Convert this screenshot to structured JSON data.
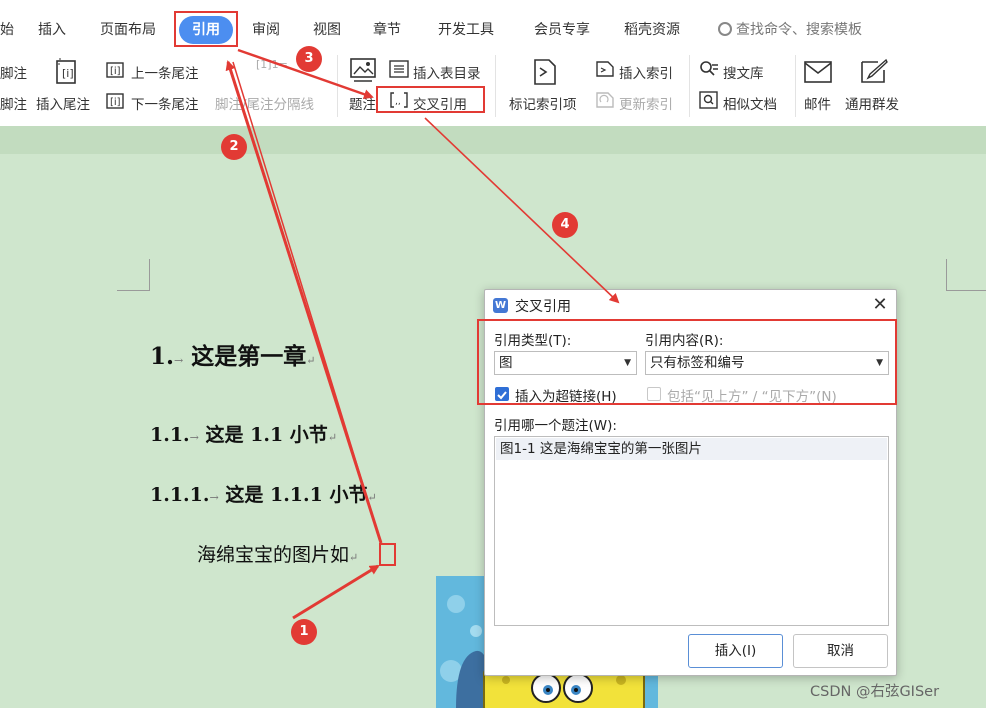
{
  "ribbon": {
    "tabs": [
      {
        "label": "始"
      },
      {
        "label": "插入"
      },
      {
        "label": "页面布局"
      },
      {
        "label": "引用"
      },
      {
        "label": "审阅"
      },
      {
        "label": "视图"
      },
      {
        "label": "章节"
      },
      {
        "label": "开发工具"
      },
      {
        "label": "会员专享"
      },
      {
        "label": "稻壳资源"
      }
    ],
    "search_label": "查找命令、搜索模板",
    "buttons": {
      "footnote_top": "脚注",
      "footnote_bottom": "脚注",
      "insert_endnote": "插入尾注",
      "prev_endnote": "上一条尾注",
      "next_endnote": "下一条尾注",
      "separator": "脚注/尾注分隔线",
      "caption": "题注",
      "insert_toc": "插入表目录",
      "cross_ref": "交叉引用",
      "mark_index": "标记索引项",
      "insert_index": "插入索引",
      "update_index": "更新索引",
      "search_library": "搜文库",
      "similar_docs": "相似文档",
      "mail": "邮件",
      "mass_mail": "通用群发"
    },
    "separator_icon_text": "[1]1="
  },
  "document": {
    "h1_num": "1.",
    "h1_text": "这是第一章",
    "h2_num": "1.1.",
    "h2_text": "这是 1.1 小节",
    "h3_num": "1.1.1.",
    "h3_text": "这是 1.1.1 小节",
    "body_text": "海绵宝宝的图片如",
    "arrow_mark": "→",
    "para_mark": "↵"
  },
  "dialog": {
    "title": "交叉引用",
    "logo": "W",
    "close": "✕",
    "ref_type_label": "引用类型(T):",
    "ref_type_value": "图",
    "ref_content_label": "引用内容(R):",
    "ref_content_value": "只有标签和编号",
    "hyperlink_label": "插入为超链接(H)",
    "hyperlink_checked": true,
    "include_label": "包括“见上方” / “见下方”(N)",
    "include_checked": false,
    "which_caption_label": "引用哪一个题注(W):",
    "captions": [
      "图1-1 这是海绵宝宝的第一张图片"
    ],
    "insert_button": "插入(I)",
    "cancel_button": "取消"
  },
  "annotations": {
    "badges": [
      "1",
      "2",
      "3",
      "4"
    ],
    "color": "#e23a34"
  },
  "watermark": "CSDN @右弦GISer",
  "colors": {
    "doc_background": "#cfe6cd",
    "accent_blue": "#4c8ef0",
    "annotation_red": "#e23a34"
  }
}
